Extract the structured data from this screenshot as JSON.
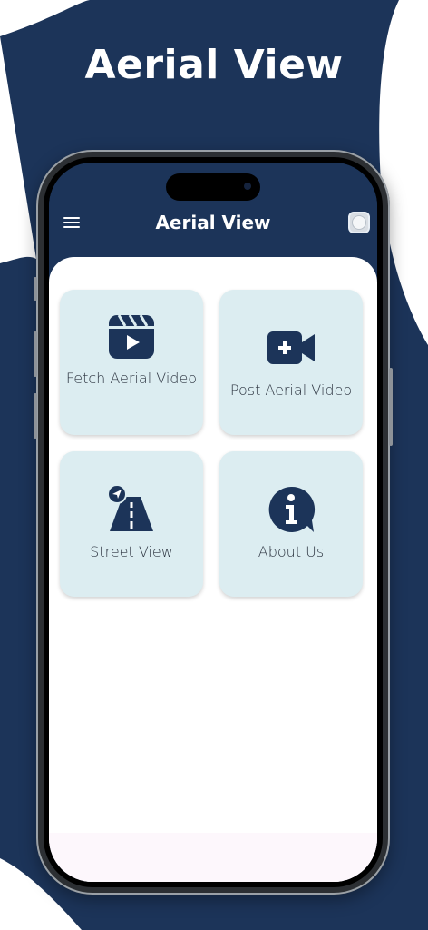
{
  "promo": {
    "title": "Aerial View"
  },
  "app": {
    "title": "Aerial View",
    "menu_icon": "menu-icon",
    "settings_icon": "settings-icon"
  },
  "cards": [
    {
      "label": "Fetch Aerial Video",
      "icon": "video-reel-play-icon"
    },
    {
      "label": "Post Aerial Video",
      "icon": "video-camera-add-icon"
    },
    {
      "label": "Street View",
      "icon": "road-navigation-icon"
    },
    {
      "label": "About Us",
      "icon": "info-chat-icon"
    }
  ],
  "colors": {
    "navy": "#1c3459",
    "card_bg": "#dcedf1",
    "icon": "#1c3459"
  }
}
